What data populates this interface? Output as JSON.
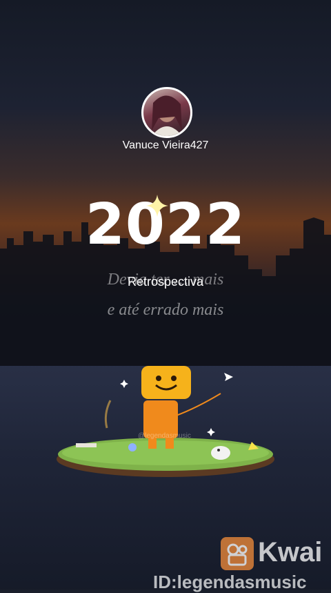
{
  "profile": {
    "username": "Vanuce Vieira427"
  },
  "hero": {
    "year": "2022",
    "title": "Retrospectiva",
    "lyric_line1": "Devia ter … mais",
    "lyric_line2": "e até errado mais"
  },
  "watermark": {
    "small_id": "@legendasmusic",
    "brand": "Kwai",
    "id_text": "ID:legendasmusic"
  },
  "colors": {
    "accent_orange": "#f5a623",
    "mascot_yellow": "#f6b21b",
    "grass_green": "#7fb24a"
  }
}
